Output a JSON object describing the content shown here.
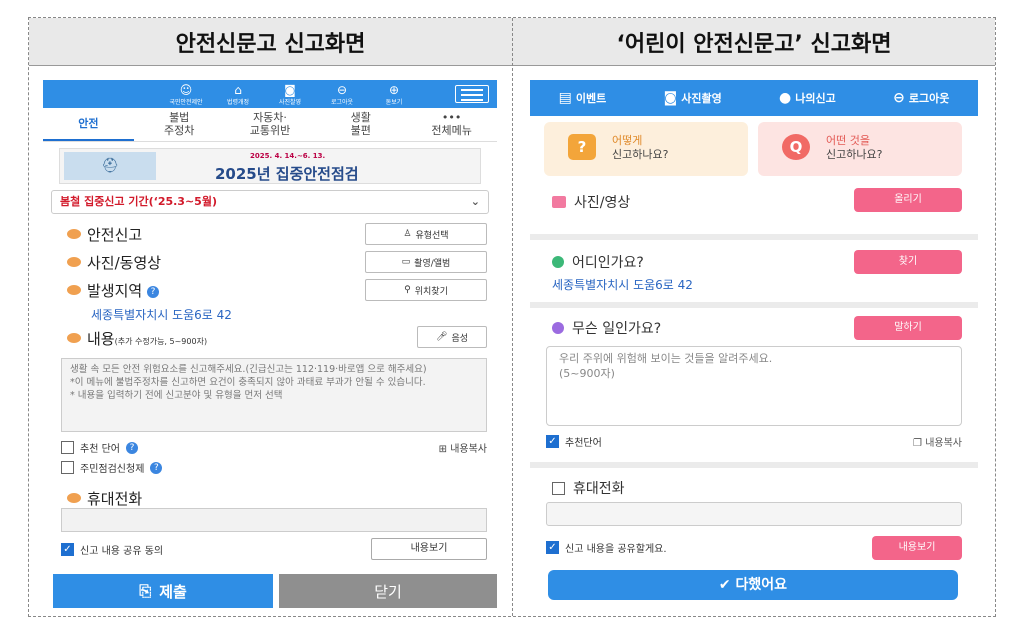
{
  "headers": {
    "left": "안전신문고 신고화면",
    "right": "‘어린이 안전신문고’ 신고화면"
  },
  "left": {
    "top_icons": [
      {
        "glyph": "☺",
        "label": "국민안전제안"
      },
      {
        "glyph": "⌂",
        "label": "법령개정"
      },
      {
        "glyph": "◙",
        "label": "사진찰영"
      },
      {
        "glyph": "⊖",
        "label": "로그아웃"
      },
      {
        "glyph": "⊕",
        "label": "돋보기"
      }
    ],
    "tabs": [
      "안전",
      "불법\n주정차",
      "자동차·\n교통위반",
      "생활\n불편",
      "•••\n전체메뉴"
    ],
    "banner": {
      "small": "2025. 4. 14.~6. 13.",
      "title": "2025년 집중안전점검"
    },
    "period": "봄철 집중신고 기간(‘25.3~5월)",
    "safety_report": "안전신고",
    "type_select": "유형선택",
    "photo_video": "사진/동영상",
    "camera_album": "촬영/앨범",
    "location_label": "발생지역",
    "location_btn": "위치찾기",
    "address": "세종특별자치시 도움6로 42",
    "content_label": "내용",
    "content_hint": "(추가 수정가능, 5~900자)",
    "voice_btn": "음성",
    "content_placeholder": "생활 속 모든 안전 위험요소를 신고해주세요.(긴급신고는 112·119·바로앱 으로 해주세요)\n*이 메뉴에 불법주정차를 신고하면 요건이 충족되지 않아 과태료 부과가 안될 수 있습니다.\n* 내용을 입력하기 전에 신고분야 및 유형을 먼저 선택",
    "recommend_word": "추천 단어",
    "copy_content": "내용복사",
    "resident_request": "주민점검신청제",
    "phone_label": "휴대전화",
    "agree_label": "신고 내용 공유 동의",
    "view_content": "내용보기",
    "submit": "제출",
    "close": "닫기"
  },
  "right": {
    "nav": [
      {
        "glyph": "▤",
        "label": "이벤트"
      },
      {
        "glyph": "◙",
        "label": "사진촬영"
      },
      {
        "glyph": "●",
        "label": "나의신고"
      },
      {
        "glyph": "⊖",
        "label": "로그아웃"
      }
    ],
    "card1": {
      "glyph": "?",
      "line1": "어떻게",
      "line2": "신고하나요?"
    },
    "card2": {
      "glyph": "Q",
      "line1": "어떤 것을",
      "line2": "신고하나요?"
    },
    "photo_label": "사진/영상",
    "upload_btn": "올리기",
    "where_label": "어디인가요?",
    "find_btn": "찾기",
    "address": "세종특별자치시 도움6로 42",
    "what_label": "무슨 일인가요?",
    "speak_btn": "말하기",
    "placeholder": "우리 주위에 위험해 보이는 것들을 알려주세요.\n(5~900자)",
    "recommend_word": "추천단어",
    "copy_content": "내용복사",
    "phone_label": "휴대전화",
    "share_label": "신고 내용을 공유할게요.",
    "view_btn": "내용보기",
    "done_btn": "다했어요"
  },
  "colors": {
    "primary_blue": "#2f8ee5",
    "pink": "#f3658a",
    "orange_dot": "#f0a050"
  }
}
